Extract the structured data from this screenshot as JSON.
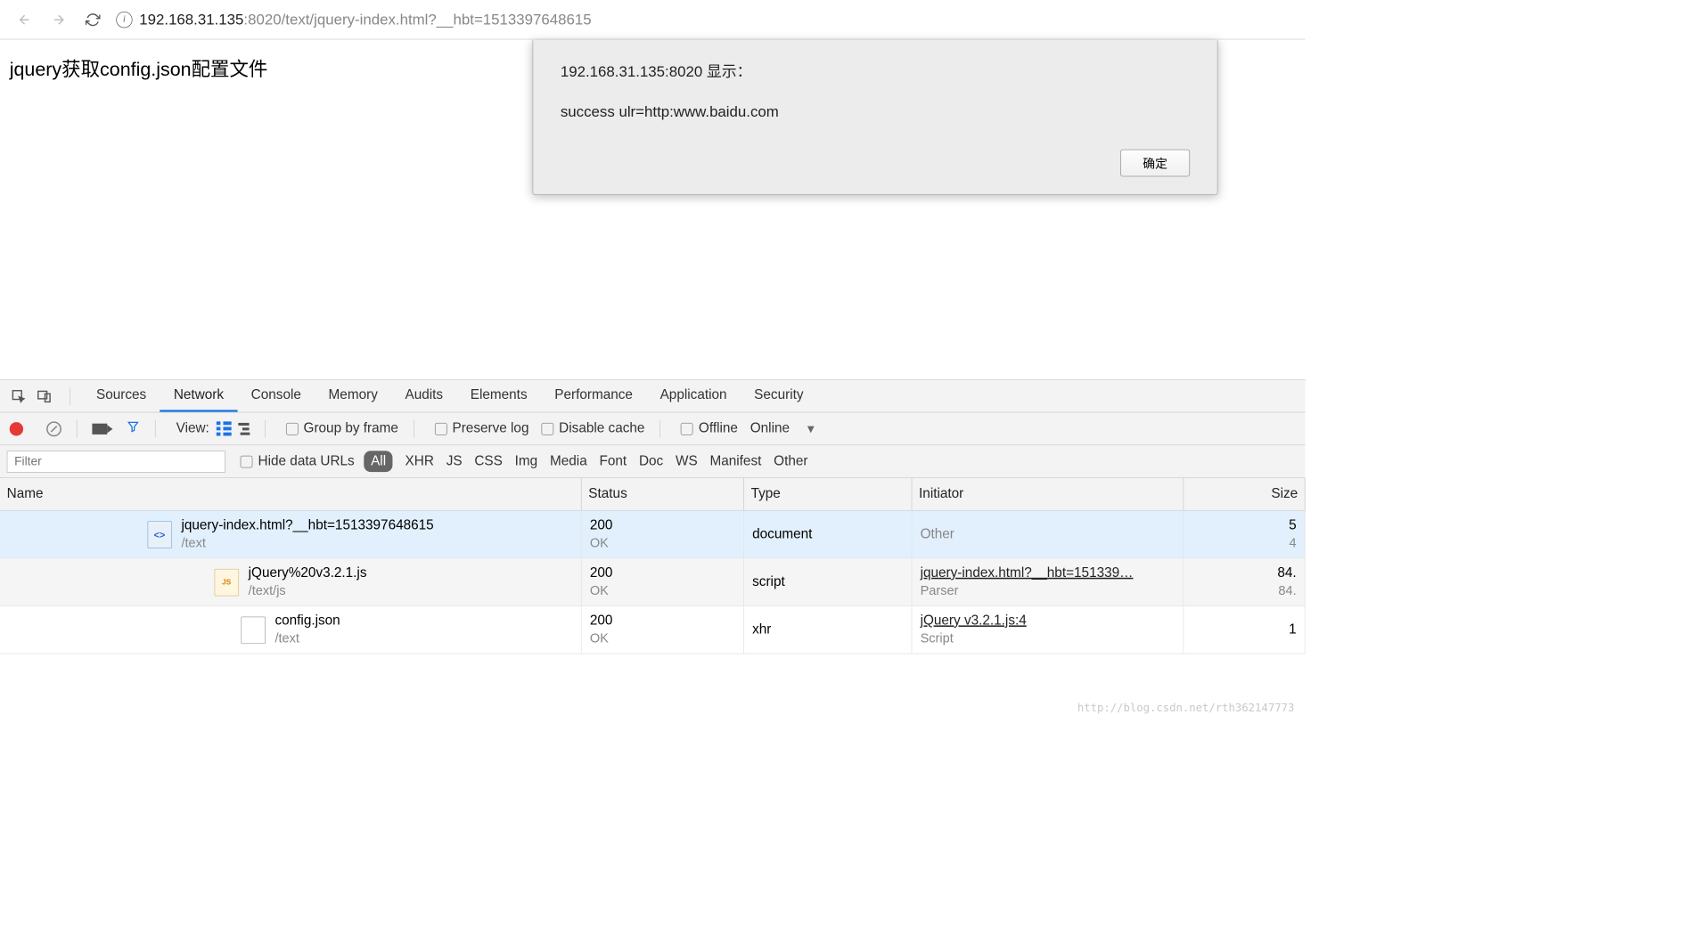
{
  "browser": {
    "url_host": "192.168.31.135",
    "url_path": ":8020/text/jquery-index.html?__hbt=1513397648615"
  },
  "page": {
    "title": "jquery获取config.json配置文件"
  },
  "alert": {
    "title": "192.168.31.135:8020 显示：",
    "message": "success ulr=http:www.baidu.com",
    "ok": "确定"
  },
  "devtools": {
    "tabs": [
      "Sources",
      "Network",
      "Console",
      "Memory",
      "Audits",
      "Elements",
      "Performance",
      "Application",
      "Security"
    ],
    "active_tab": "Network",
    "view_label": "View:",
    "group_by_frame": "Group by frame",
    "preserve_log": "Preserve log",
    "disable_cache": "Disable cache",
    "offline": "Offline",
    "throttle": "Online",
    "filter_placeholder": "Filter",
    "hide_data_urls": "Hide data URLs",
    "filter_types": [
      "All",
      "XHR",
      "JS",
      "CSS",
      "Img",
      "Media",
      "Font",
      "Doc",
      "WS",
      "Manifest",
      "Other"
    ],
    "active_filter": "All",
    "columns": {
      "name": "Name",
      "status": "Status",
      "type": "Type",
      "initiator": "Initiator",
      "size": "Size"
    },
    "rows": [
      {
        "name": "jquery-index.html?__hbt=1513397648615",
        "path": "/text",
        "status": "200",
        "status_text": "OK",
        "type": "document",
        "initiator": "Other",
        "initiator_sub": "",
        "size": "5",
        "size_sub": "4",
        "icon": "html",
        "selected": true
      },
      {
        "name": "jQuery%20v3.2.1.js",
        "path": "/text/js",
        "status": "200",
        "status_text": "OK",
        "type": "script",
        "initiator": "jquery-index.html?__hbt=151339…",
        "initiator_sub": "Parser",
        "size": "84.",
        "size_sub": "84.",
        "icon": "js",
        "selected": false
      },
      {
        "name": "config.json",
        "path": "/text",
        "status": "200",
        "status_text": "OK",
        "type": "xhr",
        "initiator": "jQuery v3.2.1.js:4",
        "initiator_sub": "Script",
        "size": "1",
        "size_sub": "",
        "icon": "json",
        "selected": false
      }
    ]
  },
  "watermark": "http://blog.csdn.net/rth362147773"
}
